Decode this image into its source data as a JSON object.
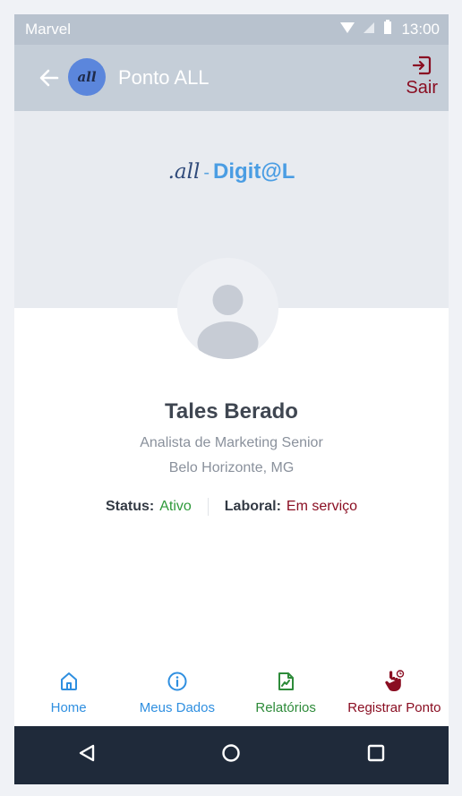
{
  "statusbar": {
    "carrier": "Marvel",
    "time": "13:00"
  },
  "appbar": {
    "title": "Ponto ALL",
    "logo_text": "all",
    "logout_label": "Sair"
  },
  "banner": {
    "brand_part1": ".all",
    "brand_part2": "-",
    "brand_part3": "Digit@L"
  },
  "profile": {
    "name": "Tales Berado",
    "role": "Analista de Marketing Senior",
    "location": "Belo Horizonte, MG",
    "status_label": "Status:",
    "status_value": "Ativo",
    "labor_label": "Laboral:",
    "labor_value": "Em serviço"
  },
  "tabs": [
    {
      "label": "Home",
      "icon": "home-icon",
      "color": "#2f8fe0"
    },
    {
      "label": "Meus Dados",
      "icon": "info-icon",
      "color": "#2f8fe0"
    },
    {
      "label": "Relatórios",
      "icon": "report-icon",
      "color": "#2e8b3a"
    },
    {
      "label": "Registrar Ponto",
      "icon": "hand-clock-icon",
      "color": "#8a0e22"
    }
  ],
  "colors": {
    "status_active": "#2e9a3a",
    "labor_value": "#8a0e22",
    "appbar_bg": "#c5ced8",
    "navbar_bg": "#1f2a3a"
  }
}
